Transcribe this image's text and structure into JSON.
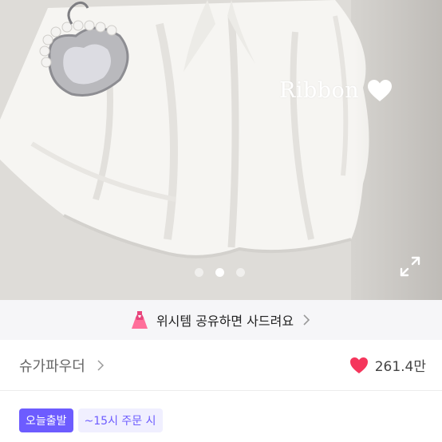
{
  "product_image": {
    "overlay_text": "Ribbon",
    "overlay_icon": "white-heart-icon",
    "pagination": {
      "total": 3,
      "active_index": 1
    },
    "expand_icon": "expand-icon"
  },
  "share_banner": {
    "icon": "dress-icon",
    "text": "위시템 공유하면 사드려요",
    "chevron_icon": "chevron-right-icon"
  },
  "shop": {
    "name": "슈가파우더",
    "chevron_icon": "chevron-right-icon",
    "like_icon": "heart-icon",
    "like_count": "261.4만",
    "like_color": "#f5365c"
  },
  "delivery": {
    "badge_label": "오늘출발",
    "cutoff_label": "~15시 주문 시",
    "accent_color": "#6d5cff"
  }
}
